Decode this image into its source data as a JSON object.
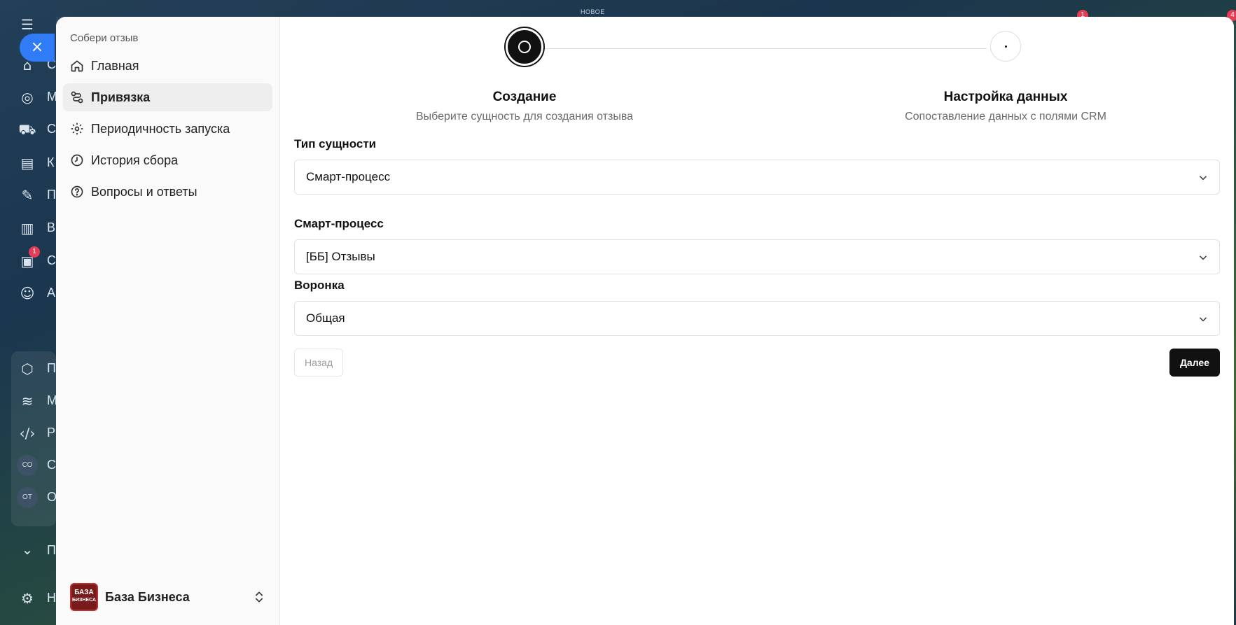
{
  "background": {
    "letters": [
      "С",
      "М",
      "С",
      "К",
      "П",
      "В",
      "С",
      "А",
      "П",
      "М",
      "Р",
      "С",
      "О",
      "П",
      "Н"
    ],
    "avatars": [
      "СО",
      "ОТ"
    ],
    "badges": [
      "1",
      "1",
      "4"
    ],
    "topbar_label": "НОВОЕ"
  },
  "close_label": "×",
  "nav": {
    "title": "Собери отзыв",
    "items": [
      {
        "label": "Главная",
        "icon": "home-icon"
      },
      {
        "label": "Привязка",
        "icon": "link-settings-icon",
        "active": true
      },
      {
        "label": "Периодичность запуска",
        "icon": "gear-icon"
      },
      {
        "label": "История сбора",
        "icon": "clock-icon"
      },
      {
        "label": "Вопросы и ответы",
        "icon": "question-icon"
      }
    ],
    "team": {
      "logo_line1": "БАЗА",
      "logo_line2": "БИЗНЕСА",
      "name": "База Бизнеса"
    }
  },
  "stepper": {
    "steps": [
      {
        "title": "Создание",
        "subtitle": "Выберите сущность для создания отзыва",
        "state": "active"
      },
      {
        "title": "Настройка данных",
        "subtitle": "Сопоставление данных с полями CRM",
        "state": "pending"
      }
    ]
  },
  "form": {
    "entity_type": {
      "label": "Тип сущности",
      "value": "Смарт-процесс"
    },
    "smart_process": {
      "label": "Смарт-процесс",
      "value": "[ББ] Отзывы"
    },
    "funnel": {
      "label": "Воронка",
      "value": "Общая"
    }
  },
  "actions": {
    "back": "Назад",
    "next": "Далее"
  },
  "colors": {
    "accent": "#2f7cf6",
    "primary_button": "#111111",
    "badge": "#e53b57"
  }
}
